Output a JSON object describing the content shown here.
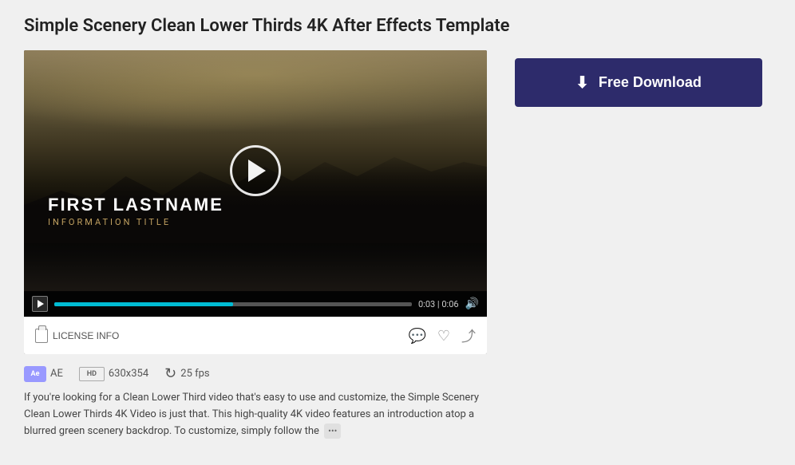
{
  "page": {
    "title": "Simple Scenery Clean Lower Thirds 4K After Effects Template"
  },
  "video": {
    "lower_thirds": {
      "name": "FIRST LASTNAME",
      "subtitle": "INFORMATION TITLE"
    },
    "time_current": "0:03",
    "time_total": "0:06",
    "progress_percent": 50
  },
  "actions": {
    "license_info": "LICENSE INFO",
    "comment_icon": "💬",
    "like_icon": "♡",
    "share_icon": "↗"
  },
  "metadata": {
    "ae_label": "Ae",
    "software": "AE",
    "resolution": "630x354",
    "fps": "25 fps",
    "hd_label": "HD"
  },
  "description": {
    "text": "If you're looking for a Clean Lower Third video that's easy to use and customize, the Simple Scenery Clean Lower Thirds 4K Video is just that. This high-quality 4K video features an introduction atop a blurred green scenery backdrop. To customize, simply follow the",
    "more_label": "•••"
  },
  "download": {
    "button_label": "Free Download",
    "icon": "⬇"
  }
}
